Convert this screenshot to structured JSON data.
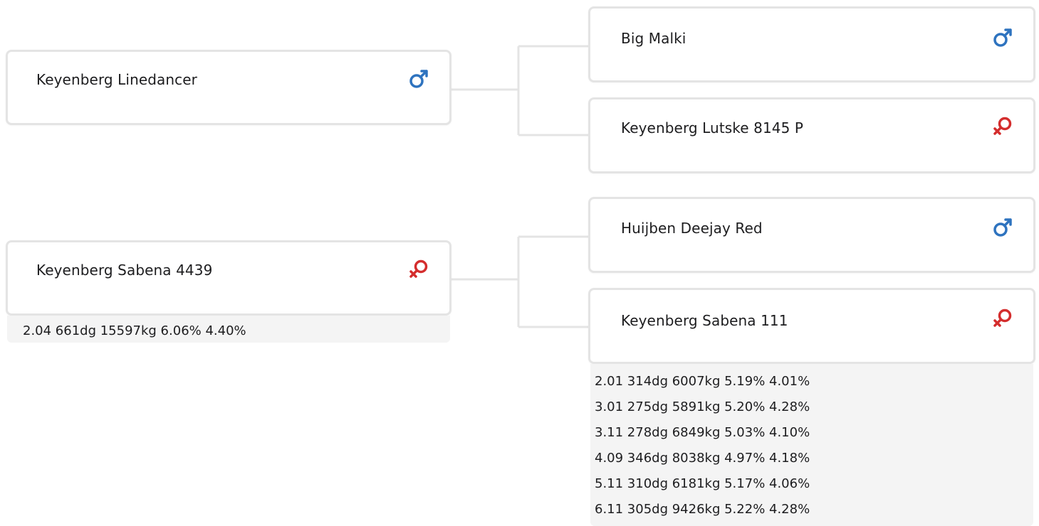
{
  "colors": {
    "male": "#2e73bf",
    "female": "#d42d2d",
    "card_border": "#e4e4e4",
    "connector": "#e4e4e4",
    "stats_background": "#f4f4f4"
  },
  "tree": {
    "subject_sire": {
      "name": "Keyenberg Linedancer",
      "sex_icon": "male-icon",
      "sire": {
        "name": "Big Malki",
        "sex_icon": "male-icon"
      },
      "dam": {
        "name": "Keyenberg Lutske 8145 P",
        "sex_icon": "female-icon"
      }
    },
    "subject_dam": {
      "name": "Keyenberg Sabena 4439",
      "sex_icon": "female-icon",
      "production": [
        "2.04 661dg 15597kg 6.06% 4.40%"
      ],
      "sire": {
        "name": "Huijben Deejay Red",
        "sex_icon": "male-icon"
      },
      "dam": {
        "name": "Keyenberg Sabena 111",
        "sex_icon": "female-icon",
        "production": [
          "2.01 314dg 6007kg 5.19% 4.01%",
          "3.01 275dg 5891kg 5.20% 4.28%",
          "3.11 278dg 6849kg 5.03% 4.10%",
          "4.09 346dg 8038kg 4.97% 4.18%",
          "5.11 310dg 6181kg 5.17% 4.06%",
          "6.11 305dg 9426kg 5.22% 4.28%"
        ]
      }
    }
  }
}
